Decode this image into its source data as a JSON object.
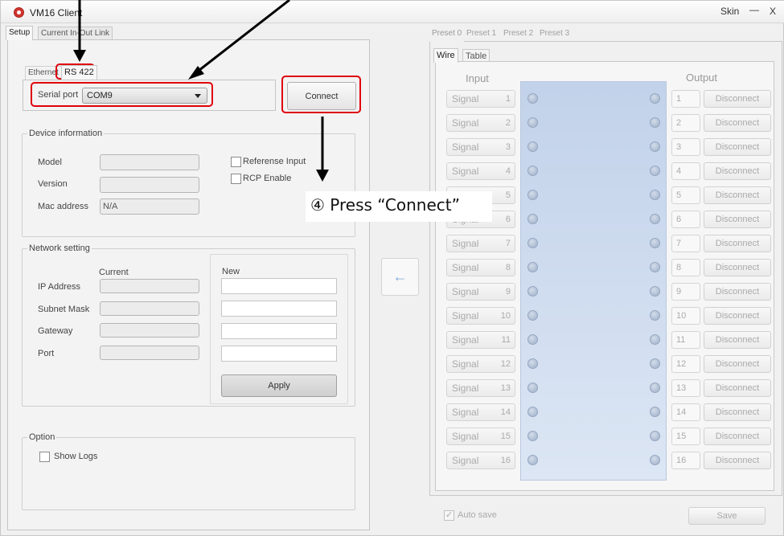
{
  "window": {
    "title": "VM16 Client",
    "skin_label": "Skin",
    "minimize_label": "—",
    "close_label": "X"
  },
  "left_tabs": [
    "Setup",
    "Current In-Out Link"
  ],
  "conn_tabs": [
    "Ethernet",
    "RS 422"
  ],
  "serial": {
    "label": "Serial port",
    "value": "COM9"
  },
  "connect_label": "Connect",
  "device_info": {
    "title": "Device information",
    "model_label": "Model",
    "version_label": "Version",
    "mac_label": "Mac address",
    "mac_value": "N/A",
    "ref_input_label": "Referense Input",
    "rcp_label": "RCP Enable"
  },
  "network": {
    "title": "Network setting",
    "current_label": "Current",
    "new_label": "New",
    "ip_label": "IP Address",
    "subnet_label": "Subnet Mask",
    "gateway_label": "Gateway",
    "port_label": "Port",
    "apply_label": "Apply"
  },
  "option": {
    "title": "Option",
    "show_logs_label": "Show Logs"
  },
  "arrow_label": "←",
  "preset_tabs": [
    "Preset 0",
    "Preset 1",
    "Preset 2",
    "Preset 3"
  ],
  "view_tabs": [
    "Wire",
    "Table"
  ],
  "wire": {
    "input_header": "Input",
    "output_header": "Output",
    "rows": [
      {
        "signal": "Signal",
        "in": "1",
        "out": "1",
        "action": "Disconnect"
      },
      {
        "signal": "Signal",
        "in": "2",
        "out": "2",
        "action": "Disconnect"
      },
      {
        "signal": "Signal",
        "in": "3",
        "out": "3",
        "action": "Disconnect"
      },
      {
        "signal": "Signal",
        "in": "4",
        "out": "4",
        "action": "Disconnect"
      },
      {
        "signal": "Signal",
        "in": "5",
        "out": "5",
        "action": "Disconnect"
      },
      {
        "signal": "Signal",
        "in": "6",
        "out": "6",
        "action": "Disconnect"
      },
      {
        "signal": "Signal",
        "in": "7",
        "out": "7",
        "action": "Disconnect"
      },
      {
        "signal": "Signal",
        "in": "8",
        "out": "8",
        "action": "Disconnect"
      },
      {
        "signal": "Signal",
        "in": "9",
        "out": "9",
        "action": "Disconnect"
      },
      {
        "signal": "Signal",
        "in": "10",
        "out": "10",
        "action": "Disconnect"
      },
      {
        "signal": "Signal",
        "in": "11",
        "out": "11",
        "action": "Disconnect"
      },
      {
        "signal": "Signal",
        "in": "12",
        "out": "12",
        "action": "Disconnect"
      },
      {
        "signal": "Signal",
        "in": "13",
        "out": "13",
        "action": "Disconnect"
      },
      {
        "signal": "Signal",
        "in": "14",
        "out": "14",
        "action": "Disconnect"
      },
      {
        "signal": "Signal",
        "in": "15",
        "out": "15",
        "action": "Disconnect"
      },
      {
        "signal": "Signal",
        "in": "16",
        "out": "16",
        "action": "Disconnect"
      }
    ]
  },
  "autosave_label": "Auto save",
  "save_label": "Save",
  "annotation": "④ Press “Connect”",
  "colors": {
    "highlight": "#e0000a",
    "matrix": "#c2d2ea",
    "arrow": "#7fa8d8"
  }
}
